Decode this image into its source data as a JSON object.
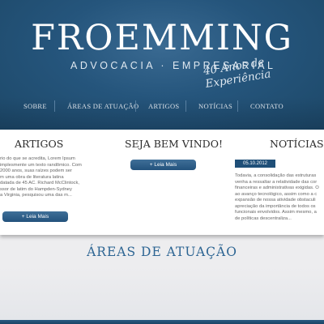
{
  "header": {
    "logo": "FROEMMING",
    "subtitle": "ADVOCACIA · EMPRESARIAL",
    "tagline": "40 Anos de Experiência"
  },
  "nav": {
    "items": [
      {
        "label": "SOBRE"
      },
      {
        "label": "ÁREAS DE ATUAÇÃO"
      },
      {
        "label": "ARTIGOS"
      },
      {
        "label": "NOTÍCIAS"
      },
      {
        "label": "CONTATO"
      }
    ]
  },
  "columns": {
    "artigos": {
      "title": "ARTIGOS",
      "text": "rio do que se acredita, Lorem Ipsum\nimplesmente um texto randômico. Com\n2000 anos, suas raízes podem ser\nm uma obra de literatura latina\ndatada de 45 AC. Richard McClintock,\nssor de latim do Hampden-Sydney\na Virginia, pesquisou uma das m...",
      "button": "+ Leia Mais"
    },
    "bemvindo": {
      "title": "SEJA BEM VINDO!",
      "button": "+ Leia Mais"
    },
    "noticias": {
      "title": "NOTÍCIAS",
      "date": "05.10.2012",
      "text": "Todavia, a consolidação das estruturas\nvenha a ressaltar a relatividade das cor\nfinanceiras e administrativas exigidas. O\nao avanço tecnológico, assim como a c\nexpansão de nossa atividade obstaculi\napreciação da importância de todos os\nfuncionais envolvidos. Assim mesmo, a\nde políticas descentraliza..."
    }
  },
  "areas": {
    "title": "ÁREAS DE ATUAÇÃO"
  },
  "colors": {
    "header_blue": "#25557c",
    "accent_blue": "#2d6593",
    "button_blue": "#23527c"
  }
}
